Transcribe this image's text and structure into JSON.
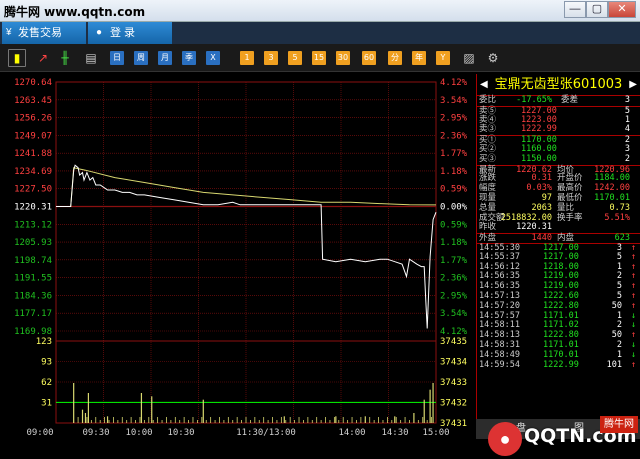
{
  "window": {
    "title": "腾牛网 www.qqtn.com",
    "minimize": "—",
    "maximize": "▢",
    "close": "✕"
  },
  "nav": {
    "sell_tab": "发售交易",
    "login_tab": "登 录"
  },
  "toolbar": {
    "buttons": [
      "日",
      "周",
      "月",
      "季",
      "X"
    ],
    "num_buttons": [
      "1",
      "3",
      "5",
      "15",
      "30",
      "60",
      "分",
      "年",
      "Y"
    ]
  },
  "chart_data": {
    "type": "line",
    "title": "",
    "price_ticks_left": [
      "1270.64",
      "1263.45",
      "1256.26",
      "1249.07",
      "1241.88",
      "1234.69",
      "1227.50",
      "1220.31",
      "1213.12",
      "1205.93",
      "1198.74",
      "1191.55",
      "1184.36",
      "1177.17",
      "1169.98"
    ],
    "pct_ticks_right": [
      "4.12%",
      "3.54%",
      "2.95%",
      "2.36%",
      "1.77%",
      "1.18%",
      "0.59%",
      "0.00%",
      "0.59%",
      "1.18%",
      "1.77%",
      "2.36%",
      "2.95%",
      "3.54%",
      "4.12%"
    ],
    "volume_ticks_left": [
      "123",
      "93",
      "62",
      "31"
    ],
    "volume_ticks_right": [
      "37435",
      "37434",
      "37433",
      "37432",
      "37431"
    ],
    "x_ticks": [
      "09:00",
      "09:30",
      "10:00",
      "10:30",
      "11:30/13:00",
      "14:00",
      "14:30",
      "15:00"
    ],
    "ylim": [
      1169.98,
      1270.64
    ],
    "prev_close": 1220.31,
    "price": [
      [
        0,
        1220.3
      ],
      [
        10,
        1220.3
      ],
      [
        12,
        1235
      ],
      [
        13,
        1237
      ],
      [
        15,
        1236
      ],
      [
        16,
        1233
      ],
      [
        18,
        1234
      ],
      [
        19,
        1231
      ],
      [
        21,
        1234
      ],
      [
        23,
        1231
      ],
      [
        25,
        1232
      ],
      [
        27,
        1229
      ],
      [
        30,
        1229
      ],
      [
        35,
        1227
      ],
      [
        40,
        1227
      ],
      [
        45,
        1226
      ],
      [
        50,
        1226
      ],
      [
        55,
        1225
      ],
      [
        60,
        1225
      ],
      [
        70,
        1224
      ],
      [
        80,
        1223
      ],
      [
        90,
        1222
      ],
      [
        100,
        1221
      ],
      [
        110,
        1221
      ],
      [
        120,
        1222
      ],
      [
        125,
        1221
      ],
      [
        130,
        1221
      ],
      [
        140,
        1221
      ],
      [
        150,
        1221
      ],
      [
        160,
        1221
      ],
      [
        170,
        1221
      ],
      [
        180,
        1221
      ],
      [
        181,
        1199
      ],
      [
        190,
        1198
      ],
      [
        200,
        1199
      ],
      [
        210,
        1198
      ],
      [
        220,
        1199
      ],
      [
        225,
        1199
      ],
      [
        230,
        1198
      ],
      [
        235,
        1197
      ],
      [
        238,
        1192
      ],
      [
        240,
        1199
      ],
      [
        245,
        1197
      ],
      [
        248,
        1196
      ],
      [
        250,
        1196
      ],
      [
        251,
        1183
      ],
      [
        252,
        1171
      ],
      [
        254,
        1200
      ],
      [
        256,
        1215
      ],
      [
        258,
        1218
      ]
    ],
    "avg_price": [
      [
        0,
        1220.3
      ],
      [
        10,
        1220.3
      ],
      [
        12,
        1236
      ],
      [
        20,
        1235
      ],
      [
        40,
        1232
      ],
      [
        60,
        1230
      ],
      [
        80,
        1228
      ],
      [
        100,
        1226
      ],
      [
        120,
        1225
      ],
      [
        140,
        1224
      ],
      [
        160,
        1223
      ],
      [
        180,
        1222
      ],
      [
        200,
        1222
      ],
      [
        220,
        1221.5
      ],
      [
        240,
        1221
      ],
      [
        258,
        1220.96
      ]
    ],
    "volume": [
      [
        12,
        60
      ],
      [
        18,
        20
      ],
      [
        20,
        15
      ],
      [
        22,
        45
      ],
      [
        35,
        10
      ],
      [
        58,
        45
      ],
      [
        65,
        40
      ],
      [
        100,
        35
      ],
      [
        155,
        10
      ],
      [
        190,
        10
      ],
      [
        210,
        10
      ],
      [
        230,
        10
      ],
      [
        243,
        15
      ],
      [
        250,
        35
      ],
      [
        254,
        50
      ],
      [
        256,
        60
      ]
    ],
    "colors": {
      "price": "#ffffff",
      "avg": "#d8d870",
      "grid": "#8b1010",
      "volume": "#d8d870",
      "vol_line": "#00ff00"
    }
  },
  "quote": {
    "name": "宝鼎无齿型张",
    "code": "601003",
    "weibi": {
      "label": "委比",
      "value": "-17.65%",
      "label2": "委差",
      "value2": "3"
    },
    "sells": [
      {
        "label": "卖⑤",
        "price": "1227.00",
        "vol": "5"
      },
      {
        "label": "卖④",
        "price": "1223.00",
        "vol": "1"
      },
      {
        "label": "卖③",
        "price": "1222.99",
        "vol": "4"
      }
    ],
    "buys": [
      {
        "label": "买①",
        "price": "1170.00",
        "vol": "2"
      },
      {
        "label": "买②",
        "price": "1160.00",
        "vol": "3"
      },
      {
        "label": "买③",
        "price": "1150.00",
        "vol": "2"
      }
    ],
    "stats": [
      {
        "l1": "最新",
        "v1": "1220.62",
        "l2": "均价",
        "v2": "1220.96"
      },
      {
        "l1": "涨跌",
        "v1": "0.31",
        "l2": "开盘价",
        "v2": "1184.00"
      },
      {
        "l1": "幅度",
        "v1": "0.03%",
        "l2": "最高价",
        "v2": "1242.00"
      },
      {
        "l1": "现量",
        "v1": "97",
        "l2": "最低价",
        "v2": "1170.01"
      },
      {
        "l1": "总量",
        "v1": "2063",
        "l2": "量比",
        "v2": "0.73"
      },
      {
        "l1": "成交额",
        "v1": "2518832.00",
        "l2": "换手率",
        "v2": "5.51%"
      },
      {
        "l1": "昨收",
        "v1": "1220.31",
        "l2": "",
        "v2": ""
      }
    ],
    "outer": {
      "l1": "外盘",
      "v1": "1440",
      "l2": "内盘",
      "v2": "623"
    },
    "ticks": [
      {
        "t": "14:55:30",
        "p": "1217.00",
        "v": "3",
        "d": "↑"
      },
      {
        "t": "14:55:37",
        "p": "1217.00",
        "v": "5",
        "d": "↑"
      },
      {
        "t": "14:56:12",
        "p": "1218.00",
        "v": "1",
        "d": "↑"
      },
      {
        "t": "14:56:35",
        "p": "1219.00",
        "v": "2",
        "d": "↑"
      },
      {
        "t": "14:56:35",
        "p": "1219.00",
        "v": "5",
        "d": "↑"
      },
      {
        "t": "14:57:13",
        "p": "1222.60",
        "v": "5",
        "d": "↑"
      },
      {
        "t": "14:57:20",
        "p": "1222.80",
        "v": "50",
        "d": "↑"
      },
      {
        "t": "14:57:57",
        "p": "1171.01",
        "v": "1",
        "d": "↓"
      },
      {
        "t": "14:58:11",
        "p": "1171.02",
        "v": "2",
        "d": "↓"
      },
      {
        "t": "14:58:13",
        "p": "1222.80",
        "v": "50",
        "d": "↑"
      },
      {
        "t": "14:58:31",
        "p": "1171.01",
        "v": "2",
        "d": "↓"
      },
      {
        "t": "14:58:49",
        "p": "1170.01",
        "v": "1",
        "d": "↓"
      },
      {
        "t": "14:59:54",
        "p": "1222.99",
        "v": "101",
        "d": "↑"
      }
    ]
  },
  "bottom": {
    "tab1": "盘",
    "tab2": "图",
    "watermark": "QQTN.com",
    "wm2": "腾牛网"
  }
}
